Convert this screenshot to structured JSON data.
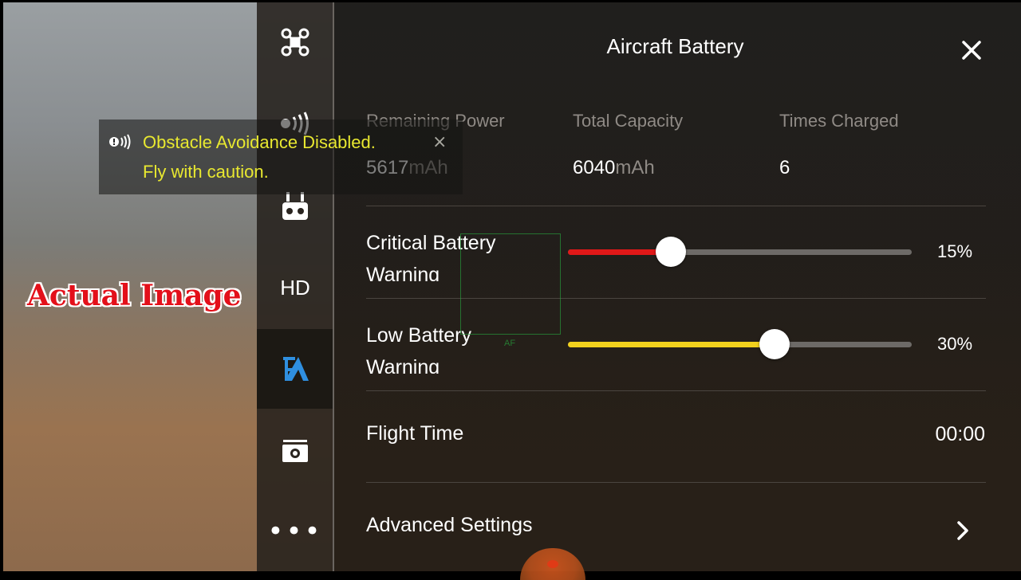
{
  "camera": {
    "caption": "Actual Image",
    "af_label": "AF"
  },
  "icon_rail": {
    "items": [
      {
        "name": "drone-icon",
        "label": ""
      },
      {
        "name": "sensor-icon",
        "label": ""
      },
      {
        "name": "remote-controller-icon",
        "label": ""
      },
      {
        "name": "hd-icon",
        "label": "HD"
      },
      {
        "name": "battery-settings-icon",
        "label": "",
        "active": true
      },
      {
        "name": "camera-icon",
        "label": ""
      },
      {
        "name": "more-icon",
        "label": "•••"
      }
    ]
  },
  "toast": {
    "line1": "Obstacle Avoidance Disabled.",
    "line2": "Fly with caution.",
    "close": "×",
    "text_color": "#e8e830"
  },
  "panel": {
    "title": "Aircraft Battery",
    "close_icon": "close-icon",
    "stats": {
      "remaining": {
        "label": "Remaining Power",
        "value": "5617",
        "unit": "mAh"
      },
      "capacity": {
        "label": "Total Capacity",
        "value": "6040",
        "unit": "mAh"
      },
      "charged": {
        "label": "Times Charged",
        "value": "6"
      }
    },
    "critical": {
      "label_line1": "Critical Battery",
      "label_line2": "Warning",
      "value": "15%",
      "percent": 15,
      "color": "#e01818"
    },
    "low": {
      "label_line1": "Low Battery",
      "label_line2": "Warning",
      "value": "30%",
      "percent": 30,
      "color": "#f2d11d"
    },
    "flight_time": {
      "label": "Flight Time",
      "value": "00:00"
    },
    "advanced": {
      "label": "Advanced Settings"
    }
  }
}
